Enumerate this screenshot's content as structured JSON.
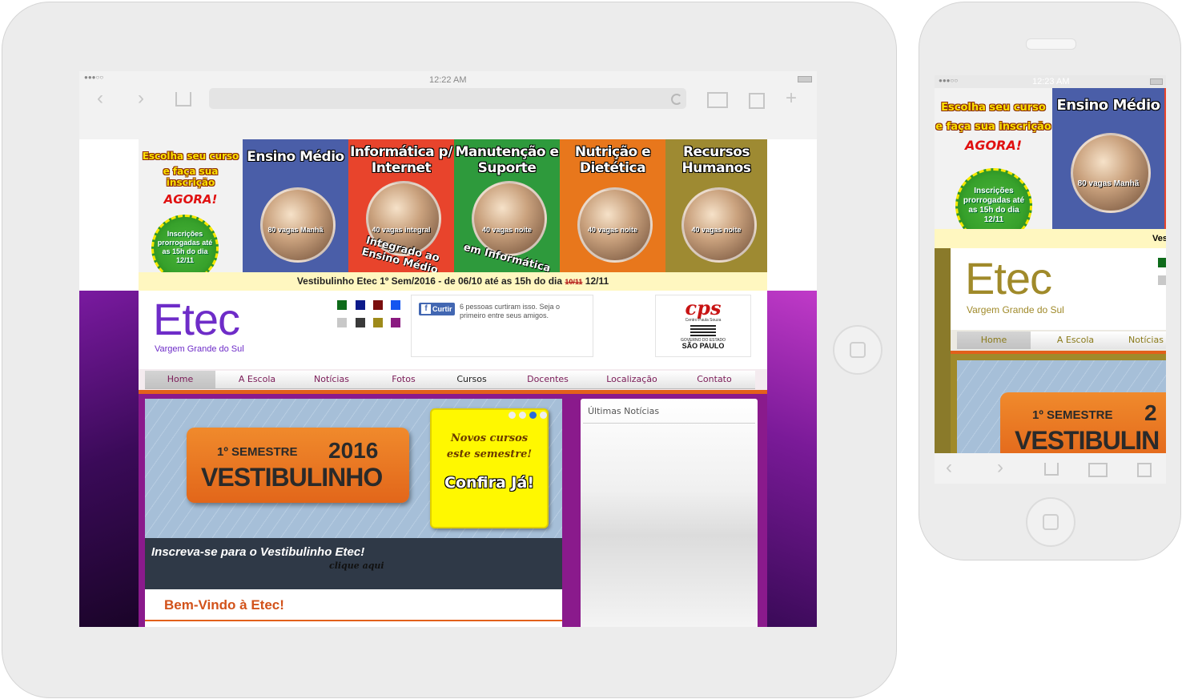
{
  "tablet": {
    "status_time": "12:22 AM",
    "signal": "●●●○○",
    "icons": {
      "back": "chevron-left-icon",
      "forward": "chevron-right-icon",
      "share": "share-icon",
      "reload": "reload-icon",
      "bookmarks": "book-icon",
      "tabs": "tabs-icon",
      "new_tab": "plus-icon"
    }
  },
  "phone": {
    "status_time": "12:23 AM",
    "signal": "●●●○○"
  },
  "banner": {
    "promo_line1": "Escolha seu curso",
    "promo_line2": "e faça sua inscrição",
    "promo_agora": "AGORA!",
    "starburst": "Inscrições prorrogadas até as 15h do dia 12/11",
    "tiles": [
      {
        "title": "Ensino Médio",
        "caption": "80 vagas Manhã",
        "sub": "",
        "color": "#4a5ea8"
      },
      {
        "title": "Informática p/ Internet",
        "caption": "40 vagas integral",
        "sub": "Integrado ao Ensino Médio",
        "color": "#e8442c"
      },
      {
        "title": "Manutenção e Suporte",
        "caption": "40 vagas noite",
        "sub": "em Informática",
        "color": "#2e9a3c"
      },
      {
        "title": "Nutrição e Dietética",
        "caption": "40 vagas noite",
        "sub": "",
        "color": "#e8771c"
      },
      {
        "title": "Recursos Humanos",
        "caption": "40 vagas noite",
        "sub": "",
        "color": "#9e8a32"
      }
    ],
    "strip_text": "Vestibulinho Etec 1º Sem/2016 - de 06/10 até as 15h do dia",
    "strip_old": "10/11",
    "strip_new": "12/11"
  },
  "site": {
    "logo": "Etec",
    "logo_sub": "Vargem Grande do Sul",
    "facebook_button": "Curtir",
    "facebook_text": "6 pessoas curtiram isso. Seja o primeiro entre seus amigos.",
    "cps": "cps",
    "cps_small": "Centro Paula Souza",
    "gov_small": "GOVERNO DO ESTADO",
    "gov": "SÃO PAULO",
    "menu": [
      "Home",
      "A Escola",
      "Notícias",
      "Fotos",
      "Cursos",
      "Docentes",
      "Localização",
      "Contato"
    ],
    "slider": {
      "semester": "1º SEMESTRE",
      "year": "2016",
      "title": "VESTIBULINHO",
      "note1": "Novos cursos este semestre!",
      "note2": "Confira Já!",
      "caption": "Inscreva-se para o Vestibulinho Etec!",
      "caption_link": "clique aqui"
    },
    "welcome": "Bem-Vindo à Etec!",
    "news_title": "Últimas Notícias",
    "colors": {
      "purple": "#8a1a8c",
      "accent": "#e2601a",
      "menu_text": "#7a1a57",
      "logo": "#6e2cc8"
    },
    "swatches": [
      "#0e6b1a",
      "#0c1a8a",
      "#7a0e0e",
      "#1456f0",
      "#c8c8c8",
      "#3a3a3a",
      "#9e8a1a",
      "#8a1a80"
    ]
  },
  "phone_site": {
    "menu": [
      "Home",
      "A Escola",
      "Notícias"
    ],
    "strip_cut": "Ves",
    "semester": "1º SEMESTRE",
    "year_cut": "2",
    "title_cut": "VESTIBULIN"
  }
}
